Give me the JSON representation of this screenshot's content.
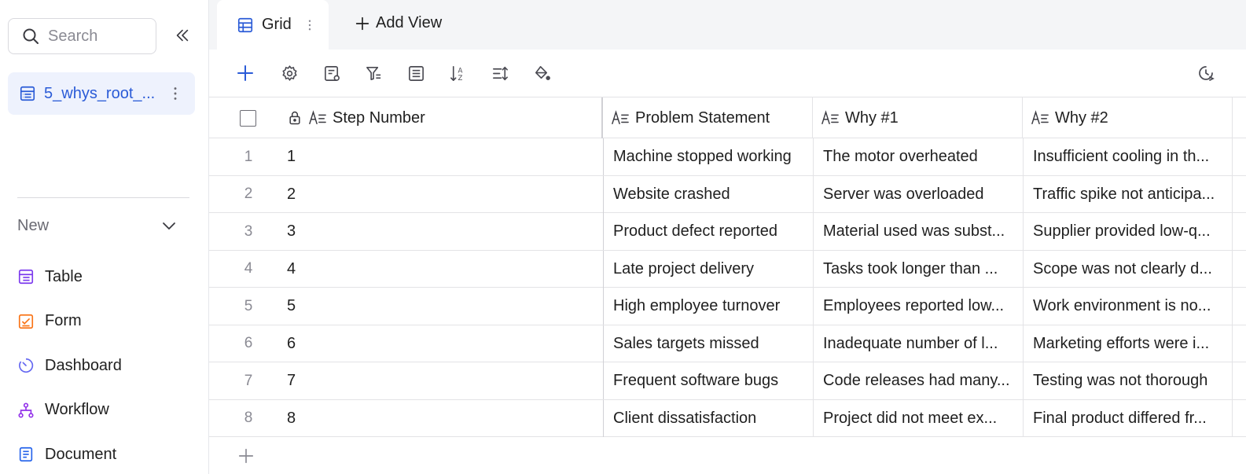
{
  "sidebar": {
    "search_placeholder": "Search",
    "table_name": "5_whys_root_...",
    "new_label": "New",
    "new_items": [
      {
        "label": "Table",
        "icon": "table-icon",
        "color": "#7c3aed"
      },
      {
        "label": "Form",
        "icon": "form-icon",
        "color": "#f97316"
      },
      {
        "label": "Dashboard",
        "icon": "dashboard-icon",
        "color": "#6366f1"
      },
      {
        "label": "Workflow",
        "icon": "workflow-icon",
        "color": "#9333ea"
      },
      {
        "label": "Document",
        "icon": "document-icon",
        "color": "#2563eb"
      }
    ]
  },
  "topbar": {
    "active_tab": "Grid",
    "add_view": "Add View"
  },
  "toolbar": {
    "icons": [
      "add-record-icon",
      "settings-icon",
      "field-settings-icon",
      "filter-icon",
      "group-icon",
      "sort-icon",
      "row-height-icon",
      "color-fill-icon",
      "history-icon"
    ]
  },
  "grid": {
    "columns": [
      "Step Number",
      "Problem Statement",
      "Why #1",
      "Why #2"
    ],
    "rows": [
      {
        "num": "1",
        "step": "1",
        "problem": "Machine stopped working",
        "why1": "The motor overheated",
        "why2": "Insufficient cooling in th..."
      },
      {
        "num": "2",
        "step": "2",
        "problem": "Website crashed",
        "why1": "Server was overloaded",
        "why2": "Traffic spike not anticipa..."
      },
      {
        "num": "3",
        "step": "3",
        "problem": "Product defect reported",
        "why1": "Material used was subst...",
        "why2": "Supplier provided low-q..."
      },
      {
        "num": "4",
        "step": "4",
        "problem": "Late project delivery",
        "why1": "Tasks took longer than ...",
        "why2": "Scope was not clearly d..."
      },
      {
        "num": "5",
        "step": "5",
        "problem": "High employee turnover",
        "why1": "Employees reported low...",
        "why2": "Work environment is no..."
      },
      {
        "num": "6",
        "step": "6",
        "problem": "Sales targets missed",
        "why1": "Inadequate number of l...",
        "why2": "Marketing efforts were i..."
      },
      {
        "num": "7",
        "step": "7",
        "problem": "Frequent software bugs",
        "why1": "Code releases had many...",
        "why2": "Testing was not thorough"
      },
      {
        "num": "8",
        "step": "8",
        "problem": "Client dissatisfaction",
        "why1": "Project did not meet ex...",
        "why2": "Final product differed fr..."
      }
    ]
  },
  "colors": {
    "accent": "#2a5bd7",
    "sidebar_selected_bg": "#eef2fd",
    "topbar_bg": "#f4f5f7"
  }
}
